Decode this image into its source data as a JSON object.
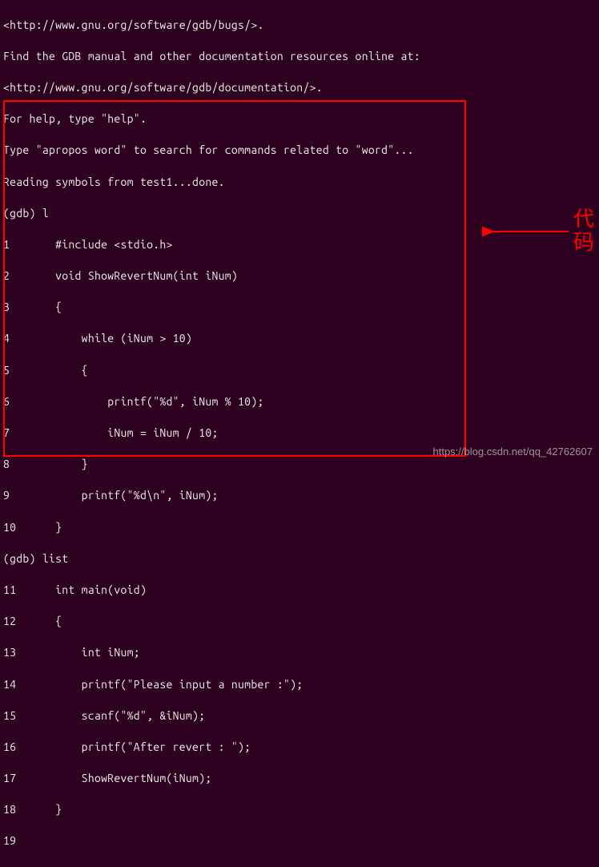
{
  "header": {
    "l1": "<http://www.gnu.org/software/gdb/bugs/>.",
    "l2": "Find the GDB manual and other documentation resources online at:",
    "l3": "<http://www.gnu.org/software/gdb/documentation/>.",
    "l4": "For help, type \"help\".",
    "l5": "Type \"apropos word\" to search for commands related to \"word\"...",
    "l6": "Reading symbols from test1...done."
  },
  "code": {
    "prompt1": "(gdb) l",
    "lines1": [
      "1       #include <stdio.h>",
      "2       void ShowRevertNum(int iNum)",
      "3       {",
      "4           while (iNum > 10)",
      "5           {",
      "6               printf(\"%d\", iNum % 10);",
      "7               iNum = iNum / 10;",
      "8           }",
      "9           printf(\"%d\\n\", iNum);",
      "10      }"
    ],
    "prompt2": "(gdb) list",
    "lines2": [
      "11      int main(void)",
      "12      {",
      "13          int iNum;",
      "14          printf(\"Please input a number :\");",
      "15          scanf(\"%d\", &iNum);",
      "16          printf(\"After revert : \");",
      "17          ShowRevertNum(iNum);",
      "18      }"
    ],
    "lastline": "19"
  },
  "annotation": {
    "label": "代码"
  },
  "watermark": "https://blog.csdn.net/qq_42762607"
}
